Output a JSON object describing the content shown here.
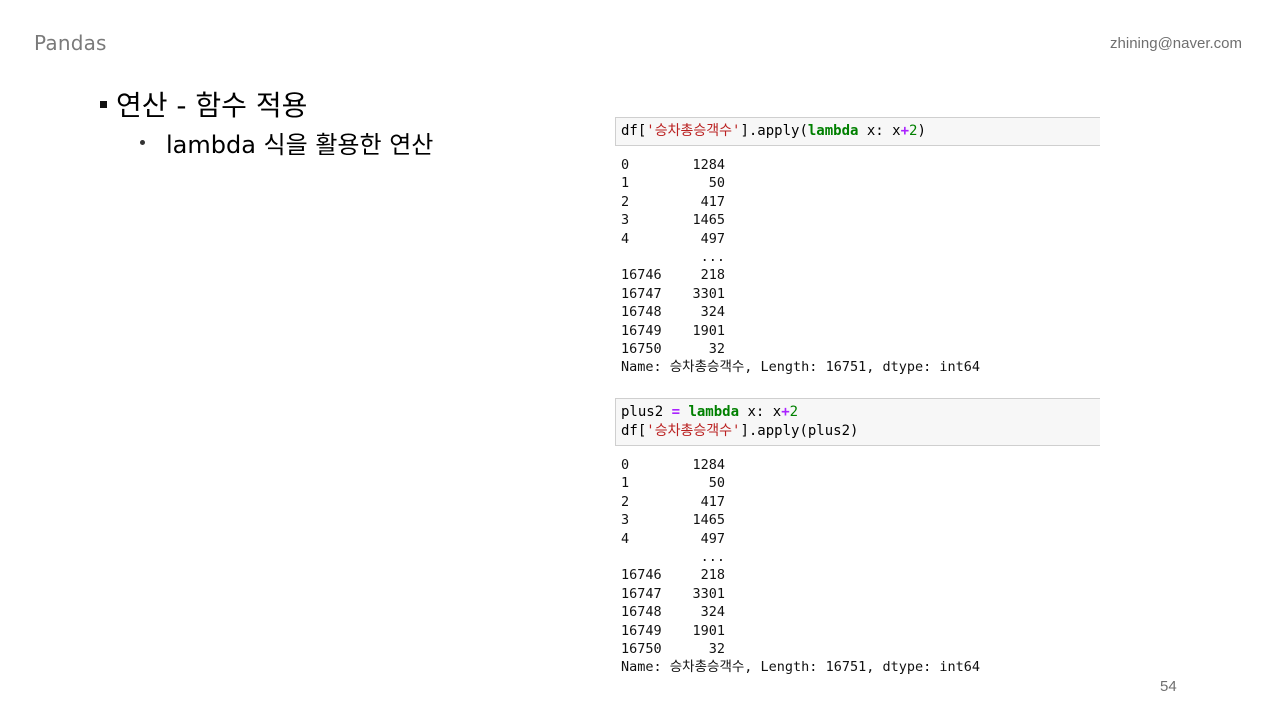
{
  "header": {
    "brand": "Pandas",
    "email": "zhining@naver.com"
  },
  "slide": {
    "heading": "연산 - 함수 적용",
    "subpoint": "lambda 식을 활용한 연산",
    "page_number": "54"
  },
  "cells": [
    {
      "input_lines": [
        [
          {
            "t": "df[",
            "c": ""
          },
          {
            "t": "'승차총승객수'",
            "c": "str"
          },
          {
            "t": "].apply(",
            "c": ""
          },
          {
            "t": "lambda",
            "c": "kw"
          },
          {
            "t": " x: x",
            "c": ""
          },
          {
            "t": "+",
            "c": "op"
          },
          {
            "t": "2",
            "c": "num"
          },
          {
            "t": ")",
            "c": ""
          }
        ]
      ],
      "output": {
        "rows": [
          {
            "idx": "0",
            "val": "1284"
          },
          {
            "idx": "1",
            "val": "50"
          },
          {
            "idx": "2",
            "val": "417"
          },
          {
            "idx": "3",
            "val": "1465"
          },
          {
            "idx": "4",
            "val": "497"
          },
          {
            "idx": "",
            "val": "..."
          },
          {
            "idx": "16746",
            "val": "218"
          },
          {
            "idx": "16747",
            "val": "3301"
          },
          {
            "idx": "16748",
            "val": "324"
          },
          {
            "idx": "16749",
            "val": "1901"
          },
          {
            "idx": "16750",
            "val": "32"
          }
        ],
        "footer": "Name: 승차총승객수, Length: 16751, dtype: int64"
      }
    },
    {
      "input_lines": [
        [
          {
            "t": "plus2 ",
            "c": ""
          },
          {
            "t": "=",
            "c": "op"
          },
          {
            "t": " ",
            "c": ""
          },
          {
            "t": "lambda",
            "c": "kw"
          },
          {
            "t": " x: x",
            "c": ""
          },
          {
            "t": "+",
            "c": "op"
          },
          {
            "t": "2",
            "c": "num"
          }
        ],
        [
          {
            "t": "df[",
            "c": ""
          },
          {
            "t": "'승차총승객수'",
            "c": "str"
          },
          {
            "t": "].apply(plus2)",
            "c": ""
          }
        ]
      ],
      "output": {
        "rows": [
          {
            "idx": "0",
            "val": "1284"
          },
          {
            "idx": "1",
            "val": "50"
          },
          {
            "idx": "2",
            "val": "417"
          },
          {
            "idx": "3",
            "val": "1465"
          },
          {
            "idx": "4",
            "val": "497"
          },
          {
            "idx": "",
            "val": "..."
          },
          {
            "idx": "16746",
            "val": "218"
          },
          {
            "idx": "16747",
            "val": "3301"
          },
          {
            "idx": "16748",
            "val": "324"
          },
          {
            "idx": "16749",
            "val": "1901"
          },
          {
            "idx": "16750",
            "val": "32"
          }
        ],
        "footer": "Name: 승차총승객수, Length: 16751, dtype: int64"
      }
    }
  ]
}
